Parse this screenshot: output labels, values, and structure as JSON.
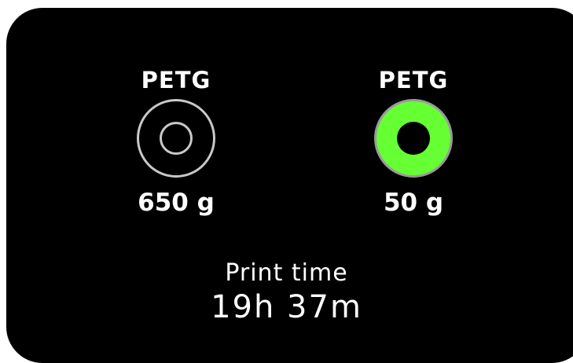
{
  "spools": [
    {
      "material": "PETG",
      "weight": "650 g",
      "state": "empty",
      "icon": "spool-icon"
    },
    {
      "material": "PETG",
      "weight": "50 g",
      "state": "active",
      "icon": "spool-icon",
      "color": "#66ff33"
    }
  ],
  "print_time": {
    "label": "Print time",
    "value": "19h 37m"
  },
  "colors": {
    "background": "#000000",
    "text": "#ffffff",
    "spool_outline": "#c8c8c8",
    "active_spool": "#66ff33"
  }
}
